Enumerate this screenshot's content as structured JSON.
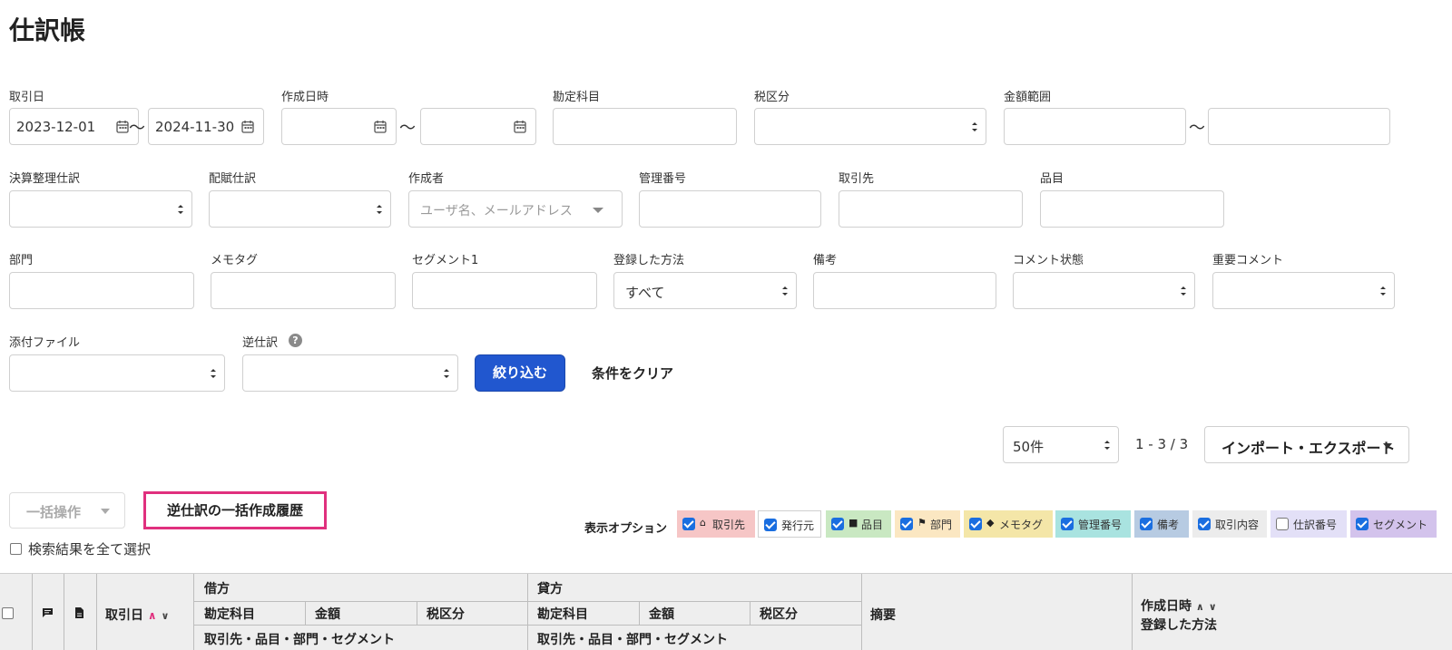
{
  "page": {
    "title": "仕訳帳"
  },
  "filters": {
    "row1": {
      "transaction_date": {
        "label": "取引日",
        "from": "2023-12-01",
        "to": "2024-11-30",
        "separator": "〜"
      },
      "created_at": {
        "label": "作成日時",
        "from": "",
        "to": "",
        "separator": "〜"
      },
      "account": {
        "label": "勘定科目",
        "value": ""
      },
      "tax_category": {
        "label": "税区分",
        "value": ""
      },
      "amount_range": {
        "label": "金額範囲",
        "from": "",
        "to": "",
        "separator": "〜"
      }
    },
    "row2": {
      "closing_entry": {
        "label": "決算整理仕訳",
        "value": ""
      },
      "allocation_entry": {
        "label": "配賦仕訳",
        "value": ""
      },
      "creator": {
        "label": "作成者",
        "placeholder": "ユーザ名、メールアドレス"
      },
      "management_number": {
        "label": "管理番号",
        "value": ""
      },
      "partner": {
        "label": "取引先",
        "value": ""
      },
      "item": {
        "label": "品目",
        "value": ""
      }
    },
    "row3": {
      "department": {
        "label": "部門",
        "value": ""
      },
      "memo_tag": {
        "label": "メモタグ",
        "value": ""
      },
      "segment1": {
        "label": "セグメント1",
        "value": ""
      },
      "registration_method": {
        "label": "登録した方法",
        "value": "すべて"
      },
      "remarks": {
        "label": "備考",
        "value": ""
      },
      "comment_status": {
        "label": "コメント状態",
        "value": ""
      },
      "important_comment": {
        "label": "重要コメント",
        "value": ""
      }
    },
    "row4": {
      "attachment": {
        "label": "添付ファイル",
        "value": ""
      },
      "reverse_entry": {
        "label": "逆仕訳",
        "value": "",
        "help_glyph": "?"
      }
    },
    "apply_label": "絞り込む",
    "clear_label": "条件をクリア"
  },
  "pager": {
    "per_page": "50件",
    "range_text": "1 - 3 / 3"
  },
  "export_label": "インポート・エクスポート",
  "bulk_action_label": "一括操作",
  "reverse_history_label": "逆仕訳の一括作成履歴",
  "select_all_label": "検索結果を全て選択",
  "display_options": {
    "label": "表示オプション",
    "items": [
      {
        "label": "取引先",
        "checked": true,
        "color": "#f6c6c6",
        "icon": "home-icon"
      },
      {
        "label": "発行元",
        "checked": true,
        "color": "#ffffff",
        "icon": ""
      },
      {
        "label": "品目",
        "checked": true,
        "color": "#c9e8c2",
        "icon": "briefcase-icon"
      },
      {
        "label": "部門",
        "checked": true,
        "color": "#fbe7c2",
        "icon": "flag-icon"
      },
      {
        "label": "メモタグ",
        "checked": true,
        "color": "#f4e6a8",
        "icon": "tag-icon"
      },
      {
        "label": "管理番号",
        "checked": true,
        "color": "#a9e3e0",
        "icon": ""
      },
      {
        "label": "備考",
        "checked": true,
        "color": "#b7cbe2",
        "icon": ""
      },
      {
        "label": "取引内容",
        "checked": true,
        "color": "#ececec",
        "icon": ""
      },
      {
        "label": "仕訳番号",
        "checked": false,
        "color": "#e3e0f7",
        "icon": ""
      },
      {
        "label": "セグメント",
        "checked": true,
        "color": "#d3c3ec",
        "icon": ""
      }
    ]
  },
  "table_header": {
    "transaction_date": "取引日",
    "debit": "借方",
    "credit": "貸方",
    "account": "勘定科目",
    "amount": "金額",
    "tax": "税区分",
    "sub_detail": "取引先・品目・部門・セグメント",
    "description": "摘要",
    "created_at": "作成日時",
    "registration_method": "登録した方法"
  }
}
